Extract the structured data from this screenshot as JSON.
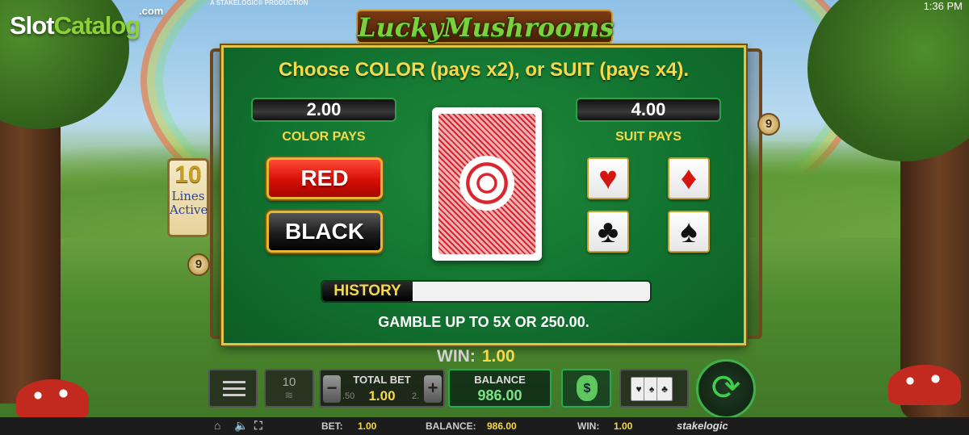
{
  "branding": {
    "watermark_slot": "Slot",
    "watermark_catalog": "Catalog",
    "watermark_com": ".com",
    "producer": "A STAKELOGIC® PRODUCTION",
    "game_logo": "LuckyMushrooms"
  },
  "clock": "1:36 PM",
  "reels": {
    "lines_count": "10",
    "lines_label_1": "Lines",
    "lines_label_2": "Active",
    "line_marker_left": "9",
    "line_marker_right": "9"
  },
  "gamble": {
    "title": "Choose COLOR (pays x2), or SUIT (pays x4).",
    "color_pays_value": "2.00",
    "color_pays_label": "COLOR PAYS",
    "suit_pays_value": "4.00",
    "suit_pays_label": "SUIT PAYS",
    "red_label": "RED",
    "black_label": "BLACK",
    "suits": [
      {
        "name": "hearts",
        "glyph": "♥",
        "color": "#d3160f"
      },
      {
        "name": "diamonds",
        "glyph": "♦",
        "color": "#d3160f"
      },
      {
        "name": "clubs",
        "glyph": "♣",
        "color": "#111111"
      },
      {
        "name": "spades",
        "glyph": "♠",
        "color": "#111111"
      }
    ],
    "history_label": "HISTORY",
    "note": "GAMBLE UP TO 5X OR 250.00."
  },
  "win": {
    "label": "WIN:",
    "value": "1.00"
  },
  "controls": {
    "lines_value": "10",
    "total_bet_label": "TOTAL BET",
    "total_bet_value": "1.00",
    "bet_prev": ".50",
    "bet_next": "2.",
    "minus": "−",
    "plus": "+",
    "balance_label": "BALANCE",
    "balance_value": "986.00"
  },
  "status_bar": {
    "bet_label": "BET:",
    "bet_value": "1.00",
    "balance_label": "BALANCE:",
    "balance_value": "986.00",
    "win_label": "WIN:",
    "win_value": "1.00",
    "brand": "stakelogic"
  },
  "colors": {
    "felt": "#127330",
    "gold": "#e3c24a",
    "red_button": "#d60e05"
  }
}
